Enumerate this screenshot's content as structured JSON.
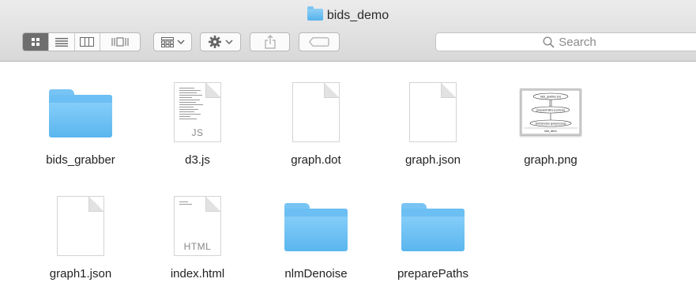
{
  "window": {
    "title": "bids_demo"
  },
  "toolbar": {
    "view_buttons": [
      {
        "name": "icon-view",
        "icon": "grid-icon",
        "active": true
      },
      {
        "name": "list-view",
        "icon": "list-icon",
        "active": false
      },
      {
        "name": "column-view",
        "icon": "columns-icon",
        "active": false
      },
      {
        "name": "cover-flow-view",
        "icon": "cover-flow-icon",
        "active": false
      }
    ],
    "arrange_icon": "arrange-grid-icon",
    "action_icon": "gear-icon",
    "share_icon": "share-icon",
    "tag_icon": "tag-icon",
    "search_placeholder": "Search"
  },
  "files": [
    {
      "name": "bids_grabber",
      "kind": "folder"
    },
    {
      "name": "d3.js",
      "kind": "document",
      "ext": "JS"
    },
    {
      "name": "graph.dot",
      "kind": "document",
      "ext": ""
    },
    {
      "name": "graph.json",
      "kind": "document",
      "ext": ""
    },
    {
      "name": "graph.png",
      "kind": "image"
    },
    {
      "name": "graph1.json",
      "kind": "document",
      "ext": ""
    },
    {
      "name": "index.html",
      "kind": "document",
      "ext": "HTML"
    },
    {
      "name": "nlmDenoise",
      "kind": "folder"
    },
    {
      "name": "preparePaths",
      "kind": "folder"
    }
  ],
  "graph_preview": {
    "nodes": [
      "bids_grabber (io)",
      "preparePaths (custom)",
      "nlmDenoise (preprocess)"
    ],
    "footer": "bids_demo"
  },
  "colors": {
    "folder_top": "#8ed2fb",
    "folder_bottom": "#5ab6ee",
    "toolbar_bg": "#e3e3e3",
    "active_view": "#6e6e6e"
  }
}
